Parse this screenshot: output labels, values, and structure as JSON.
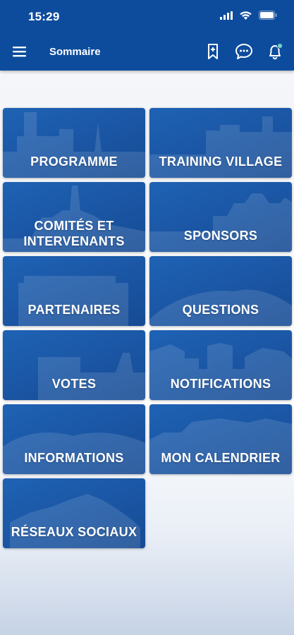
{
  "status_bar": {
    "time": "15:29"
  },
  "header": {
    "title": "Sommaire"
  },
  "icons": {
    "menu": "hamburger-menu-icon",
    "bookmark": "bookmark-add-icon",
    "chat": "chat-bubble-icon",
    "notifications": "bell-notification-icon"
  },
  "colors": {
    "header": "#0d4c9d",
    "tile": "#1a55a3",
    "text": "#ffffff"
  },
  "tiles": [
    {
      "label": "PROGRAMME"
    },
    {
      "label": "TRAINING VILLAGE"
    },
    {
      "label_line1": "COMITÉS ET",
      "label_line2": "INTERVENANTS"
    },
    {
      "label": "SPONSORS"
    },
    {
      "label": "PARTENAIRES"
    },
    {
      "label": "QUESTIONS"
    },
    {
      "label": "VOTES"
    },
    {
      "label": "NOTIFICATIONS"
    },
    {
      "label": "INFORMATIONS"
    },
    {
      "label": "MON CALENDRIER"
    },
    {
      "label": "RÉSEAUX SOCIAUX"
    }
  ]
}
